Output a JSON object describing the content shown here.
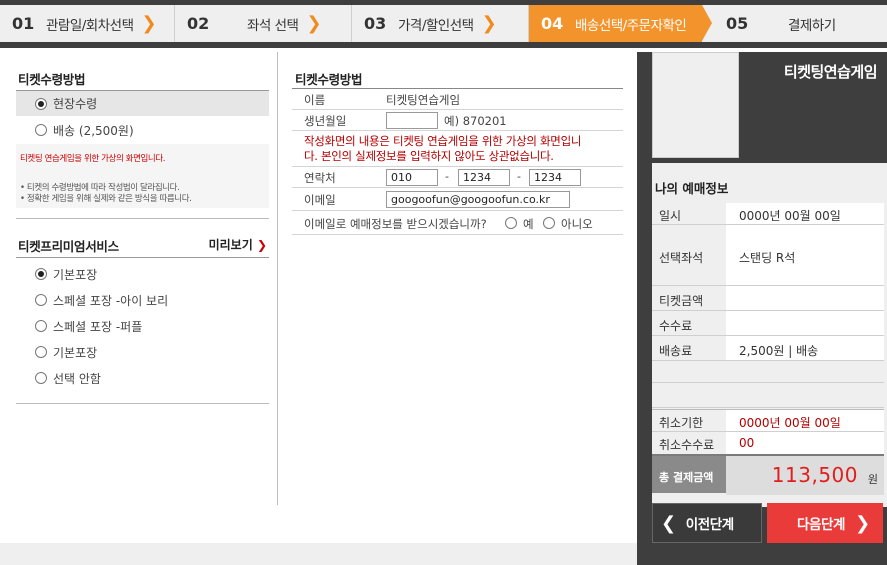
{
  "steps": [
    {
      "num": "01",
      "label": "관람일/회차선택",
      "arrow": "❯"
    },
    {
      "num": "02",
      "label": "좌석 선택",
      "arrow": "❯"
    },
    {
      "num": "03",
      "label": "가격/할인선택",
      "arrow": "❯"
    },
    {
      "num": "04",
      "label": "배송선택/주문자확인",
      "active": true
    },
    {
      "num": "05",
      "label": "결제하기"
    }
  ],
  "ticket_receive": {
    "title": "티켓수령방법",
    "options": [
      {
        "label": "현장수령",
        "selected": true
      },
      {
        "label": "배송 (2,500원)",
        "selected": false
      }
    ],
    "notice_red": "티켓팅 연습게임을 위한 가상의 화면입니다.",
    "notice_lines": [
      "• 티켓의 수령방법에 따라 작성법이 달라집니다.",
      "• 정확한 게임을 위해 실제와 같은 방식을 따릅니다."
    ]
  },
  "premium": {
    "title": "티켓프리미엄서비스",
    "preview_label": "미리보기",
    "preview_arrow": "❯",
    "options": [
      {
        "label": "기본포장",
        "selected": true
      },
      {
        "label": "스페셜 포장 -아이 보리",
        "selected": false
      },
      {
        "label": "스페셜 포장 -퍼플",
        "selected": false
      },
      {
        "label": "기본포장",
        "selected": false
      },
      {
        "label": "선택 안함",
        "selected": false
      }
    ]
  },
  "form": {
    "title": "티켓수령방법",
    "name_label": "이름",
    "name_value": "티켓팅연습게임",
    "birth_label": "생년월일",
    "birth_value": "",
    "birth_example": "예) 870201",
    "warning_line1": "작성화면의 내용은 티켓팅 연습게임을 위한 가상의 화면입니",
    "warning_line2": "다. 본인의 실제정보를 입력하지 않아도 상관없습니다.",
    "phone_label": "연락처",
    "phone1": "010",
    "phone2": "1234",
    "phone3": "1234",
    "phone_sep": "-",
    "email_label": "이메일",
    "email_value": "googoofun@googoofun.co.kr",
    "email_question": "이메일로 예매정보를 받으시겠습니까?",
    "email_yes": "예",
    "email_no": "아니오"
  },
  "summary": {
    "event_title": "티켓팅연습게임",
    "header": "나의 예매정보",
    "date_label": "일시",
    "date_value": "0000년 00월 00일",
    "seat_label": "선택좌석",
    "seat_value": "스탠딩 R석",
    "ticket_price_label": "티켓금액",
    "ticket_price_value": "",
    "fee_label": "수수료",
    "fee_value": "",
    "delivery_label": "배송료",
    "delivery_value": "2,500원 | 배송",
    "cancel_deadline_label": "취소기한",
    "cancel_deadline_value": "0000년 00월 00일",
    "cancel_fee_label": "취소수수료",
    "cancel_fee_value": "00",
    "total_label": "총 결제금액",
    "total_value": "113,500",
    "total_unit": "원"
  },
  "buttons": {
    "prev_label": "이전단계",
    "prev_arrow": "❮",
    "next_label": "다음단계",
    "next_arrow": "❯"
  },
  "colors": {
    "accent_orange": "#f3932b",
    "next_button": "#ea3b3b",
    "total_amount": "#e21d1d",
    "panel_dark": "#3e3e3e"
  }
}
